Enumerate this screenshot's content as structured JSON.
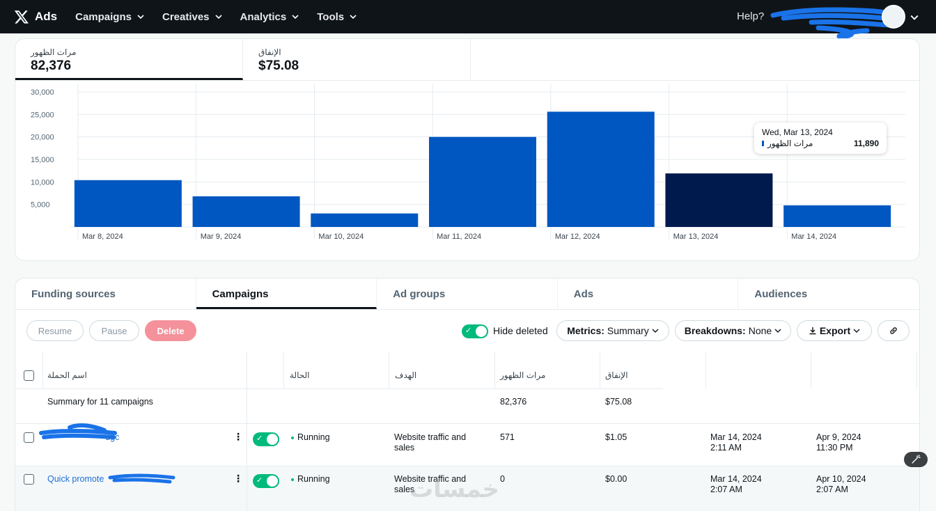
{
  "nav": {
    "brand": "Ads",
    "items": [
      "Campaigns",
      "Creatives",
      "Analytics",
      "Tools"
    ],
    "help": "Help?"
  },
  "metrics": [
    {
      "label": "مرات الظهور",
      "value": "82,376"
    },
    {
      "label": "الإنفاق",
      "value": "$75.08"
    }
  ],
  "chart_data": {
    "type": "bar",
    "categories": [
      "Mar 8, 2024",
      "Mar 9, 2024",
      "Mar 10, 2024",
      "Mar 11, 2024",
      "Mar 12, 2024",
      "Mar 13, 2024",
      "Mar 14, 2024"
    ],
    "series": [
      {
        "name": "مرات الظهور",
        "values": [
          10400,
          6800,
          3000,
          20000,
          25600,
          11890,
          4800
        ]
      }
    ],
    "yticks": [
      "5,000",
      "10,000",
      "15,000",
      "20,000",
      "25,000",
      "30,000"
    ],
    "ylim": [
      0,
      30000
    ],
    "highlight_index": 5,
    "bar_color": "#0057c2",
    "highlight_color": "#001a4d",
    "grid": true
  },
  "tooltip": {
    "date": "Wed, Mar 13, 2024",
    "label": "مرات الظهور",
    "value": "11,890"
  },
  "tabs": [
    "Funding sources",
    "Campaigns",
    "Ad groups",
    "Ads",
    "Audiences"
  ],
  "toolbar": {
    "resume": "Resume",
    "pause": "Pause",
    "delete": "Delete",
    "hide_deleted": "Hide deleted",
    "metrics_label": "Metrics:",
    "metrics_value": "Summary",
    "breakdowns_label": "Breakdowns:",
    "breakdowns_value": "None",
    "export": "Export"
  },
  "table": {
    "headers": [
      "اسم الحملة",
      "الحالة",
      "الهدف",
      "مرات الظهور",
      "الإنفاق"
    ],
    "summary": {
      "name": "Summary for 11 campaigns",
      "impressions": "82,376",
      "spend": "$75.08"
    },
    "rows": [
      {
        "name": "-ugc",
        "status": "Running",
        "objective_l1": "Website traffic and",
        "objective_l2": "sales",
        "impressions": "571",
        "spend": "$1.05",
        "start_date": "Mar 14, 2024",
        "start_time": "2:11 AM",
        "end_date": "Apr 9, 2024",
        "end_time": "11:30 PM"
      },
      {
        "name": "Quick promote",
        "status": "Running",
        "objective_l1": "Website traffic and",
        "objective_l2": "sales",
        "impressions": "0",
        "spend": "$0.00",
        "start_date": "Mar 14, 2024",
        "start_time": "2:07 AM",
        "end_date": "Apr 10, 2024",
        "end_time": "2:07 AM"
      }
    ]
  },
  "watermark": "خمسات"
}
